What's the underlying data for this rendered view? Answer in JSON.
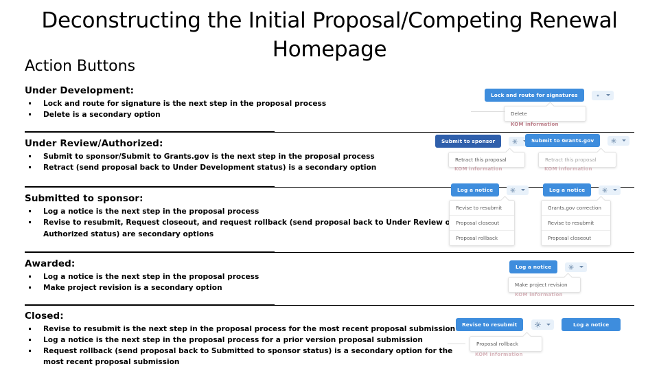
{
  "slide": {
    "title": "Deconstructing the Initial Proposal/Competing Renewal Homepage",
    "subtitle": "Action Buttons"
  },
  "colors": {
    "primary_blue": "#3e8ddd",
    "deep_blue": "#2f5fab",
    "gear_chip": "#e8f1fa",
    "menu_text": "#5b5b5b",
    "red_note": "#a14a5a"
  },
  "sections": [
    {
      "id": "under-development",
      "heading": "Under Development:",
      "bullets": [
        "Lock and route for signature is the next step in the proposal process",
        "Delete is a secondary option"
      ]
    },
    {
      "id": "under-review-authorized",
      "heading": "Under Review/Authorized:",
      "bullets": [
        "Submit to sponsor/Submit to Grants.gov is the next step in the proposal process",
        "Retract (send proposal back to Under Development status) is a secondary option"
      ]
    },
    {
      "id": "submitted-to-sponsor",
      "heading": "Submitted to sponsor:",
      "bullets": [
        "Log a notice is the next step in the proposal process",
        "Revise to resubmit, Request closeout, and request rollback (send proposal back to Under Review or Authorized status) are secondary options"
      ]
    },
    {
      "id": "awarded",
      "heading": "Awarded:",
      "bullets": [
        "Log a notice is the next step in the proposal process",
        "Make project revision is a secondary option"
      ]
    },
    {
      "id": "closed",
      "heading": "Closed:",
      "bullets": [
        "Revise to resubmit is the next step in the proposal process for the most recent proposal submission",
        "Log a notice is the next step in the proposal process for a prior version proposal submission",
        "Request rollback (send proposal back to Submitted to sponsor status) is a secondary option for the most recent proposal submission"
      ]
    }
  ],
  "screenshots": {
    "under_development": {
      "primary_button": "Lock and route for signatures",
      "gear_icon": "gear-icon",
      "caret_icon": "chevron-down-icon",
      "menu_items": [
        "Delete"
      ],
      "note": "KOM information"
    },
    "under_review_left": {
      "primary_button": "Submit to sponsor",
      "gear_icon": "gear-icon",
      "caret_icon": "chevron-down-icon",
      "menu_items": [
        "Retract this proposal"
      ],
      "note": "KOM information"
    },
    "under_review_right": {
      "primary_button": "Submit to Grants.gov",
      "gear_icon": "gear-icon",
      "caret_icon": "chevron-down-icon",
      "menu_items": [
        "Retract this proposal"
      ],
      "note": "KOM information"
    },
    "submitted_left": {
      "primary_button": "Log a notice",
      "gear_icon": "gear-icon",
      "caret_icon": "chevron-down-icon",
      "menu_items": [
        "Revise to resubmit",
        "Proposal closeout",
        "Proposal rollback"
      ]
    },
    "submitted_right": {
      "primary_button": "Log a notice",
      "gear_icon": "gear-icon",
      "caret_icon": "chevron-down-icon",
      "menu_items": [
        "Grants.gov correction",
        "Revise to resubmit",
        "Proposal closeout"
      ]
    },
    "awarded": {
      "primary_button": "Log a notice",
      "gear_icon": "gear-icon",
      "caret_icon": "chevron-down-icon",
      "menu_items": [
        "Make project revision"
      ],
      "note": "KOM information"
    },
    "closed_left": {
      "primary_button": "Revise to resubmit",
      "gear_icon": "gear-icon",
      "caret_icon": "chevron-down-icon",
      "menu_items": [
        "Proposal rollback"
      ],
      "note": "KOM information"
    },
    "closed_right": {
      "primary_button": "Log a notice"
    }
  }
}
